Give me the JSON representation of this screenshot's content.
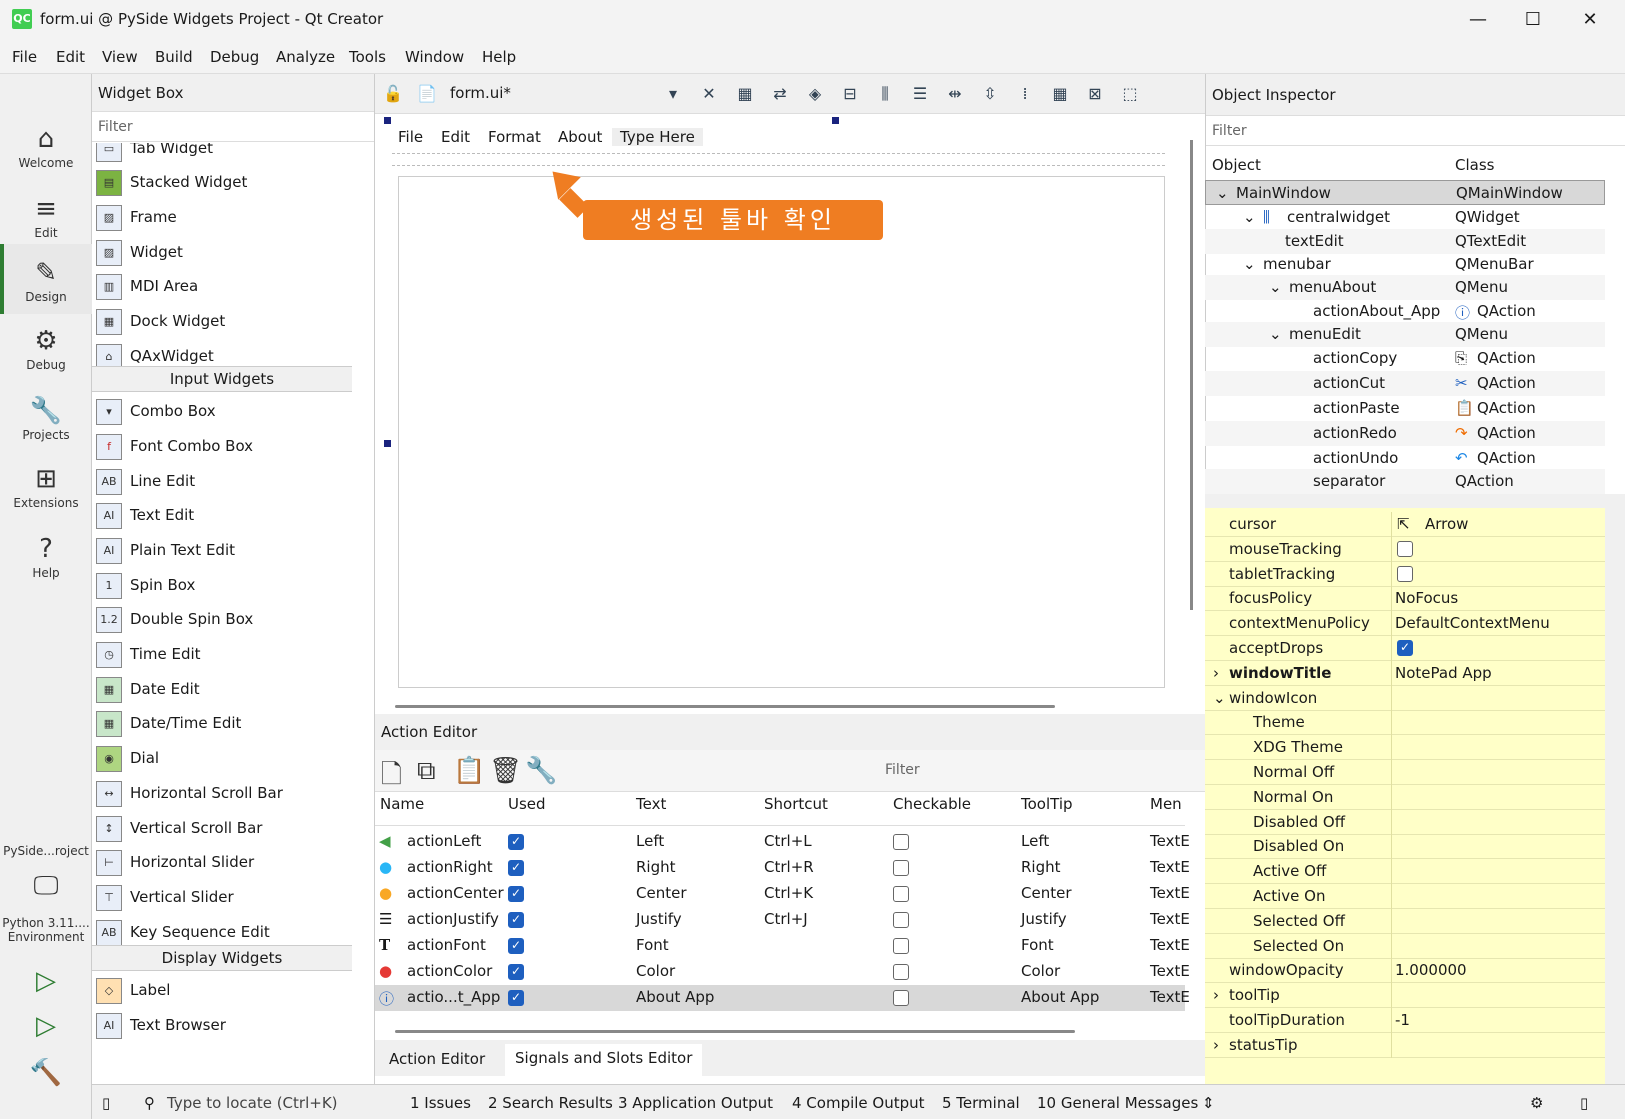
{
  "window": {
    "title": "form.ui @ PySide Widgets Project - Qt Creator",
    "icon": "QC"
  },
  "menu": [
    "File",
    "Edit",
    "View",
    "Build",
    "Debug",
    "Analyze",
    "Tools",
    "Window",
    "Help"
  ],
  "modes": [
    {
      "label": "Welcome",
      "icon": "home-icon"
    },
    {
      "label": "Edit",
      "icon": "edit-icon"
    },
    {
      "label": "Design",
      "icon": "design-icon"
    },
    {
      "label": "Debug",
      "icon": "debug-icon"
    },
    {
      "label": "Projects",
      "icon": "projects-icon"
    },
    {
      "label": "Extensions",
      "icon": "extensions-icon"
    },
    {
      "label": "Help",
      "icon": "help-icon"
    }
  ],
  "project": {
    "name": "PySide...roject",
    "env": "Python 3.11....\nEnvironment"
  },
  "widget_box": {
    "title": "Widget Box",
    "filter": "Filter",
    "items1": [
      "Tab Widget",
      "Stacked Widget",
      "Frame",
      "Widget",
      "MDI Area",
      "Dock Widget",
      "QAxWidget"
    ],
    "cat_input": "Input Widgets",
    "items2": [
      "Combo Box",
      "Font Combo Box",
      "Line Edit",
      "Text Edit",
      "Plain Text Edit",
      "Spin Box",
      "Double Spin Box",
      "Time Edit",
      "Date Edit",
      "Date/Time Edit",
      "Dial",
      "Horizontal Scroll Bar",
      "Vertical Scroll Bar",
      "Horizontal Slider",
      "Vertical Slider",
      "Key Sequence Edit"
    ],
    "cat_display": "Display Widgets",
    "items3": [
      "Label",
      "Text Browser"
    ]
  },
  "designer": {
    "file": "form.ui*",
    "form_menu": [
      "File",
      "Edit",
      "Format",
      "About",
      "Type Here"
    ],
    "callout": "생성된 툴바 확인"
  },
  "action_editor": {
    "title": "Action Editor",
    "filter": "Filter",
    "columns": [
      "Name",
      "Used",
      "Text",
      "Shortcut",
      "Checkable",
      "ToolTip",
      "Men"
    ],
    "rows": [
      {
        "name": "actionLeft",
        "text": "Left",
        "shortcut": "Ctrl+L",
        "tooltip": "Left",
        "menu": "TextE"
      },
      {
        "name": "actionRight",
        "text": "Right",
        "shortcut": "Ctrl+R",
        "tooltip": "Right",
        "menu": "TextE"
      },
      {
        "name": "actionCenter",
        "text": "Center",
        "shortcut": "Ctrl+K",
        "tooltip": "Center",
        "menu": "TextE"
      },
      {
        "name": "actionJustify",
        "text": "Justify",
        "shortcut": "Ctrl+J",
        "tooltip": "Justify",
        "menu": "TextE"
      },
      {
        "name": "actionFont",
        "text": "Font",
        "shortcut": "",
        "tooltip": "Font",
        "menu": "TextE"
      },
      {
        "name": "actionColor",
        "text": "Color",
        "shortcut": "",
        "tooltip": "Color",
        "menu": "TextE"
      },
      {
        "name": "actio...t_App",
        "text": "About App",
        "shortcut": "",
        "tooltip": "About App",
        "menu": "TextE"
      }
    ],
    "tabs": [
      "Action Editor",
      "Signals and Slots Editor"
    ]
  },
  "object_inspector": {
    "title": "Object Inspector",
    "filter": "Filter",
    "col_object": "Object",
    "col_class": "Class",
    "rows": [
      {
        "obj": "MainWindow",
        "cls": "QMainWindow"
      },
      {
        "obj": "centralwidget",
        "cls": "QWidget"
      },
      {
        "obj": "textEdit",
        "cls": "QTextEdit"
      },
      {
        "obj": "menubar",
        "cls": "QMenuBar"
      },
      {
        "obj": "menuAbout",
        "cls": "QMenu"
      },
      {
        "obj": "actionAbout_App",
        "cls": "QAction"
      },
      {
        "obj": "menuEdit",
        "cls": "QMenu"
      },
      {
        "obj": "actionCopy",
        "cls": "QAction"
      },
      {
        "obj": "actionCut",
        "cls": "QAction"
      },
      {
        "obj": "actionPaste",
        "cls": "QAction"
      },
      {
        "obj": "actionRedo",
        "cls": "QAction"
      },
      {
        "obj": "actionUndo",
        "cls": "QAction"
      },
      {
        "obj": "separator",
        "cls": "QAction"
      }
    ]
  },
  "properties": [
    {
      "name": "cursor",
      "value": "Arrow"
    },
    {
      "name": "mouseTracking",
      "value": ""
    },
    {
      "name": "tabletTracking",
      "value": ""
    },
    {
      "name": "focusPolicy",
      "value": "NoFocus"
    },
    {
      "name": "contextMenuPolicy",
      "value": "DefaultContextMenu"
    },
    {
      "name": "acceptDrops",
      "value": ""
    },
    {
      "name": "windowTitle",
      "value": "NotePad App"
    },
    {
      "name": "windowIcon",
      "value": ""
    },
    {
      "name": "Theme",
      "value": ""
    },
    {
      "name": "XDG Theme",
      "value": ""
    },
    {
      "name": "Normal Off",
      "value": ""
    },
    {
      "name": "Normal On",
      "value": ""
    },
    {
      "name": "Disabled Off",
      "value": ""
    },
    {
      "name": "Disabled On",
      "value": ""
    },
    {
      "name": "Active Off",
      "value": ""
    },
    {
      "name": "Active On",
      "value": ""
    },
    {
      "name": "Selected Off",
      "value": ""
    },
    {
      "name": "Selected On",
      "value": ""
    },
    {
      "name": "windowOpacity",
      "value": "1.000000"
    },
    {
      "name": "toolTip",
      "value": ""
    },
    {
      "name": "toolTipDuration",
      "value": "-1"
    },
    {
      "name": "statusTip",
      "value": ""
    }
  ],
  "status": {
    "locate": "Type to locate (Ctrl+K)",
    "panes": [
      "1  Issues",
      "2  Search Results",
      "3  Application Output",
      "4  Compile Output",
      "5  Terminal",
      "10  General Messages"
    ]
  },
  "colors": {
    "accent": "#ef7d22",
    "prop_bg": "#ffffc8",
    "check": "#1e5fbf"
  }
}
